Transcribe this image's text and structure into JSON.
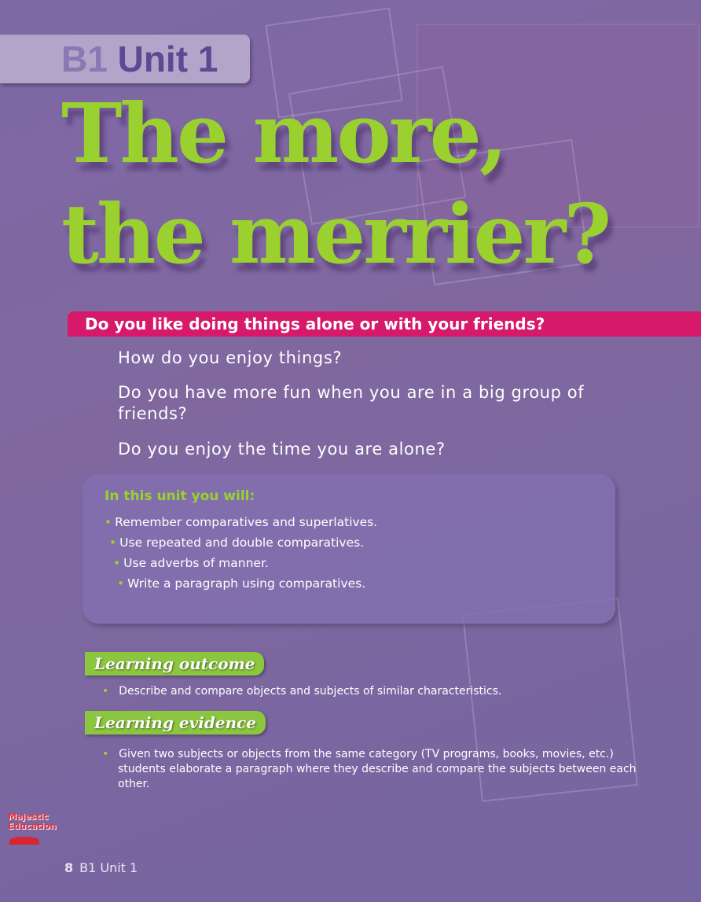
{
  "header": {
    "level": "B1",
    "unit": "Unit 1"
  },
  "title": {
    "line1": "The more,",
    "line2": "the merrier?"
  },
  "banner": "Do you like doing things alone or with your friends?",
  "questions": [
    "How do you enjoy things?",
    "Do you have more fun when you are in a big group of friends?",
    "Do you enjoy the time you are alone?"
  ],
  "unit_box": {
    "heading": "In this unit you will:",
    "items": [
      "Remember comparatives and superlatives.",
      "Use repeated and double comparatives.",
      "Use adverbs of manner.",
      "Write a paragraph using comparatives."
    ]
  },
  "learning_outcome": {
    "label": "Learning outcome",
    "text": "Describe and compare objects and subjects of similar characteristics."
  },
  "learning_evidence": {
    "label": "Learning evidence",
    "text": "Given two subjects or objects from the same category (TV programs, books, movies, etc.) students elaborate a paragraph where they describe and compare the subjects between each other."
  },
  "logo": {
    "line1": "Majestic",
    "line2": "Education"
  },
  "footer": {
    "page": "8",
    "label": "B1 Unit 1"
  },
  "colors": {
    "background": "#7a66a0",
    "green": "#9bd12f",
    "pink": "#d6196a"
  }
}
